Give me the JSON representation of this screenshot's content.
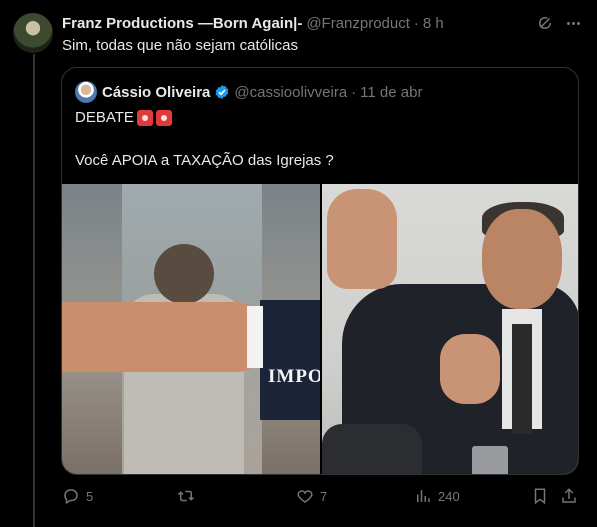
{
  "tweet": {
    "author_name": "Franz Productions —Born Again|-",
    "author_handle": "@Franzproduct",
    "separator": "·",
    "time": "8 h",
    "text": "Sim, todas que não sejam católicas"
  },
  "quote": {
    "author_name": "Cássio Oliveira",
    "author_handle": "@cassioolivveira",
    "separator": "·",
    "date": "11 de abr",
    "line1": "DEBATE",
    "line2": "Você APOIA a TAXAÇÃO das Igrejas ?",
    "media_left_text": "IMPO"
  },
  "actions": {
    "replies": "5",
    "retweets": "",
    "likes": "7",
    "views": "240"
  },
  "colors": {
    "background": "#000000",
    "text": "#e7e9ea",
    "muted": "#71767b",
    "border": "#2f3336",
    "verified": "#1d9bf0"
  }
}
